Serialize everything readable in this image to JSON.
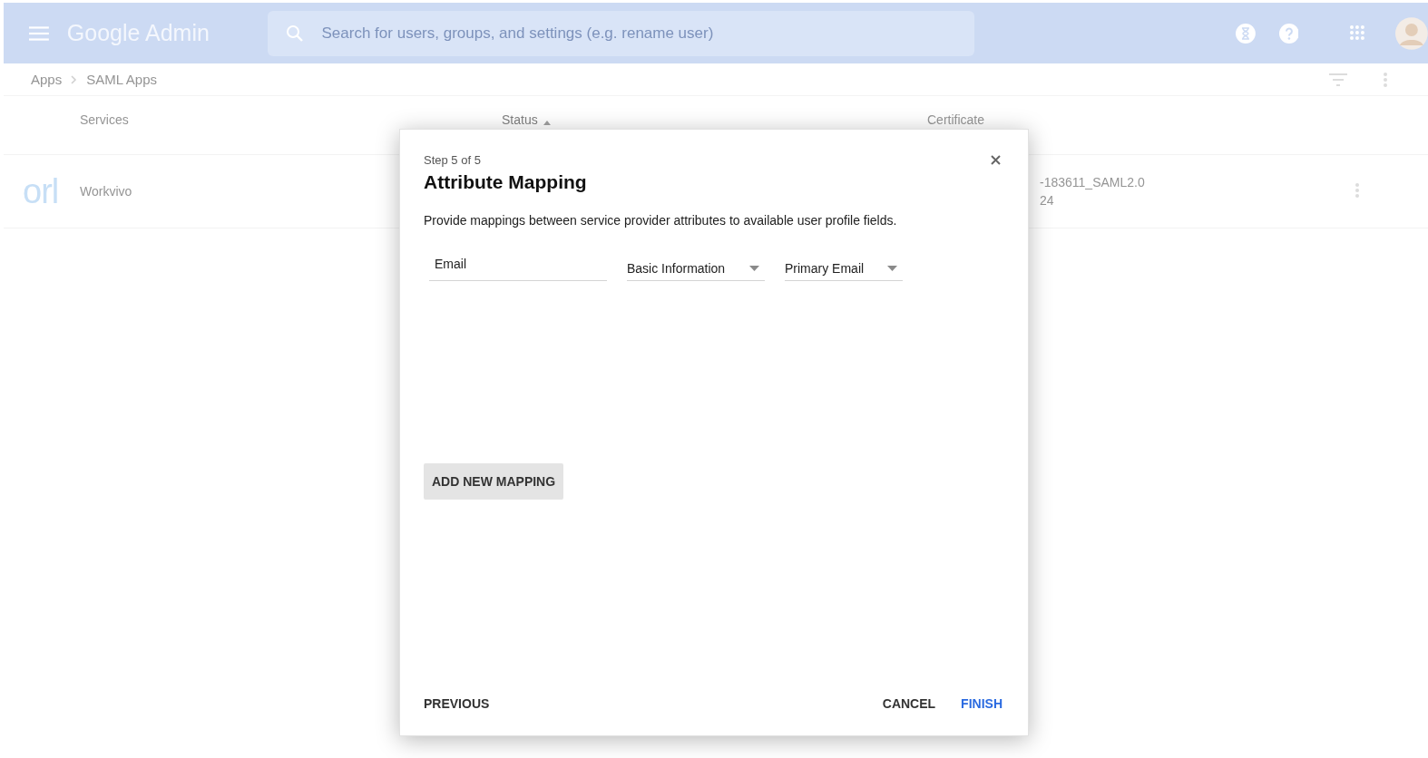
{
  "header": {
    "title": "Google Admin",
    "search": {
      "placeholder": "Search for users, groups, and settings (e.g. rename user)"
    }
  },
  "breadcrumb": [
    "Apps",
    "SAML Apps"
  ],
  "table": {
    "columns": [
      {
        "label": "Services",
        "sorted": false
      },
      {
        "label": "Status",
        "sorted": true
      },
      {
        "label": "Certificate",
        "sorted": false
      }
    ],
    "rows": [
      {
        "logo": "orl",
        "name": "Workvivo",
        "certificate": [
          "-183611_SAML2.0",
          "24"
        ]
      }
    ]
  },
  "dialog": {
    "step": "Step 5 of 5",
    "title": "Attribute Mapping",
    "description": "Provide mappings between service provider attributes to available user profile fields.",
    "mappings": [
      {
        "attribute": "Email",
        "category": "Basic Information",
        "field": "Primary Email"
      }
    ],
    "add_button": "ADD NEW MAPPING",
    "back_button": "PREVIOUS",
    "actions": [
      {
        "label": "CANCEL",
        "kind": "plain"
      },
      {
        "label": "FINISH",
        "kind": "primary"
      }
    ]
  }
}
